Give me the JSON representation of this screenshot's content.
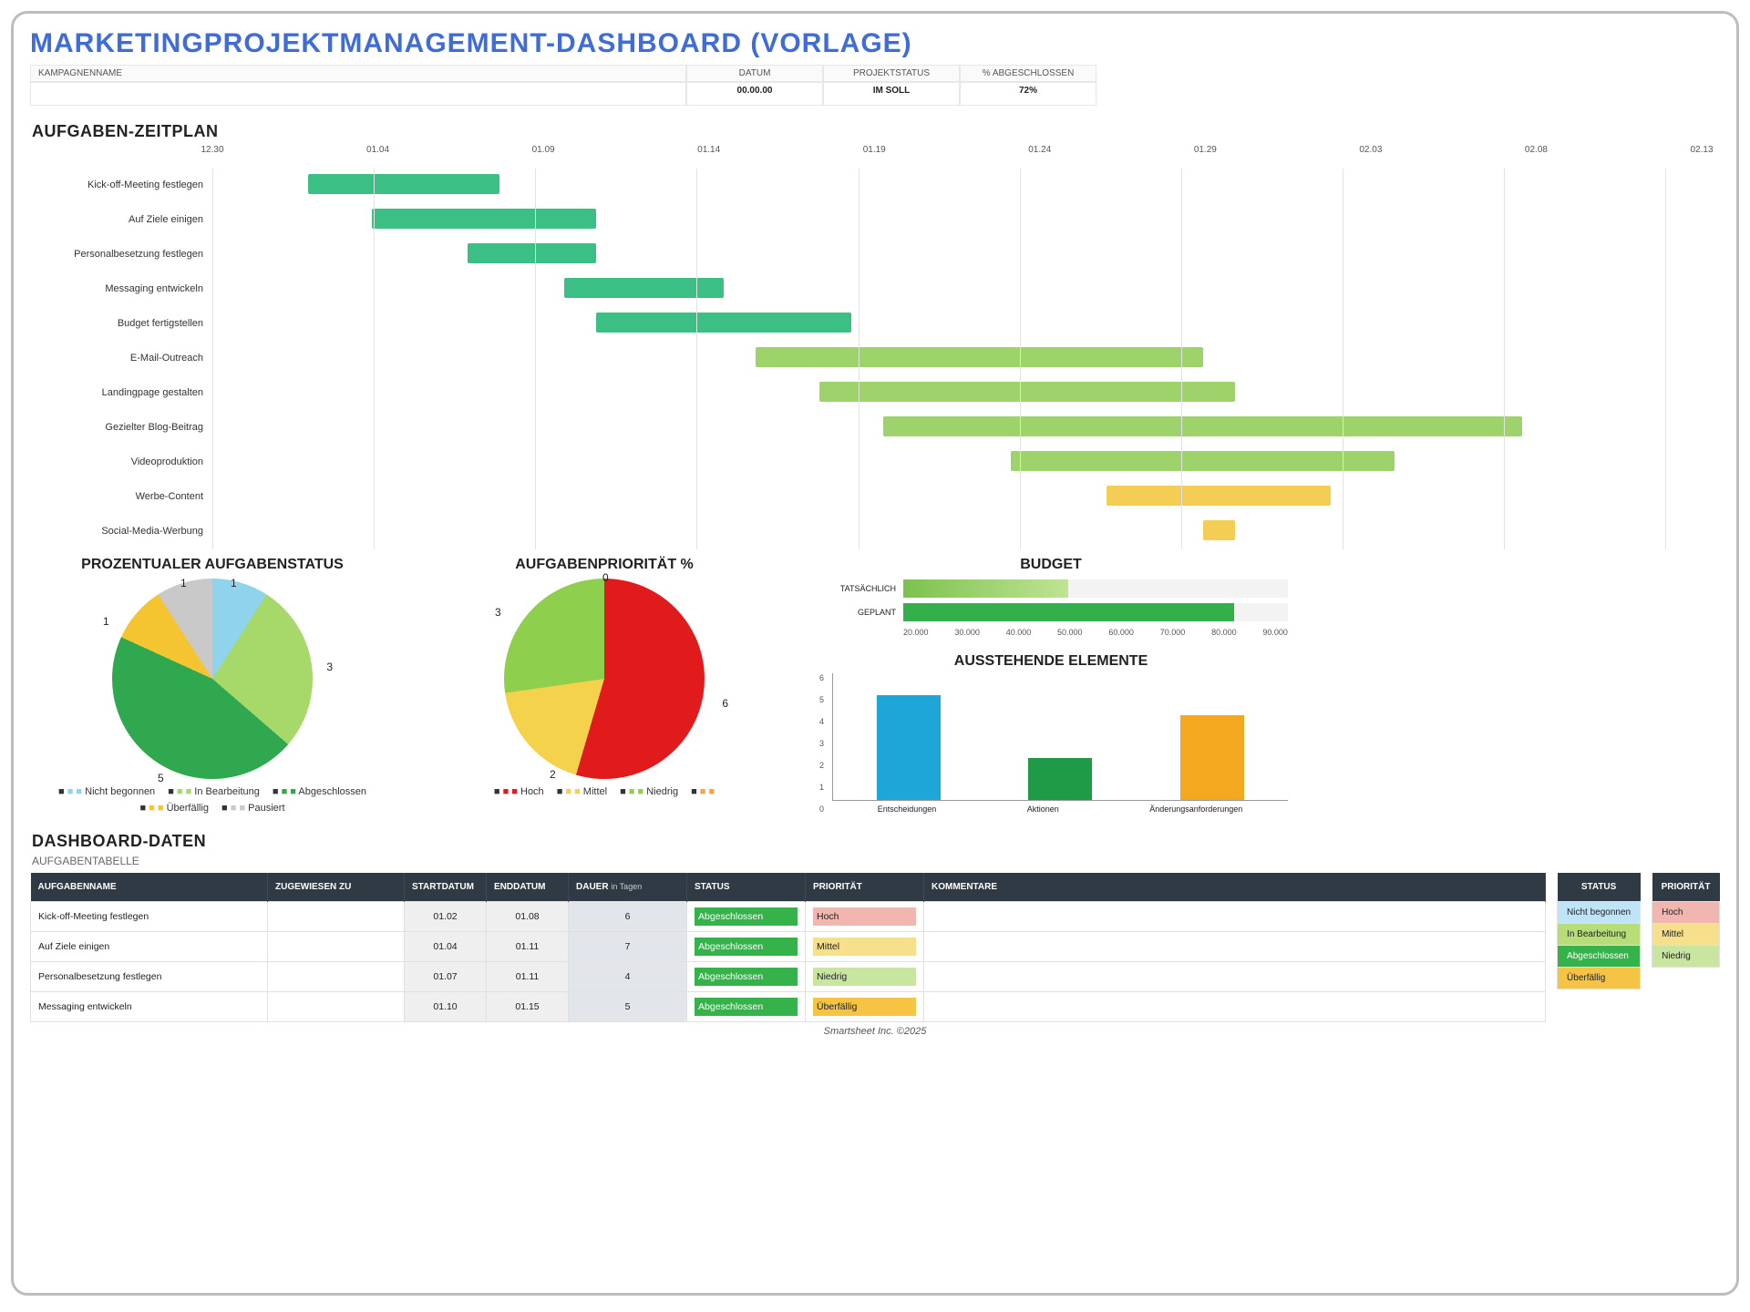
{
  "title": "MARKETINGPROJEKTMANAGEMENT-DASHBOARD (VORLAGE)",
  "header": {
    "labels": {
      "name": "KAMPAGNENNAME",
      "date": "DATUM",
      "status": "PROJEKTSTATUS",
      "pct": "% ABGESCHLOSSEN"
    },
    "values": {
      "name": "",
      "date": "00.00.00",
      "status": "IM SOLL",
      "pct": "72%"
    }
  },
  "sections": {
    "gantt": "AUFGABEN-ZEITPLAN",
    "data": "DASHBOARD-DATEN",
    "table": "AUFGABENTABELLE"
  },
  "chart_titles": {
    "pie_status": "PROZENTUALER AUFGABENSTATUS",
    "pie_priority": "AUFGABENPRIORITÄT %",
    "budget": "BUDGET",
    "outstanding": "AUSSTEHENDE ELEMENTE"
  },
  "gantt": {
    "axis": [
      "12.30",
      "01.04",
      "01.09",
      "01.14",
      "01.19",
      "01.24",
      "01.29",
      "02.03",
      "02.08",
      "02.13"
    ],
    "tasks": [
      {
        "label": "Kick-off-Meeting festlegen",
        "color": "#3bbf84"
      },
      {
        "label": "Auf Ziele einigen",
        "color": "#3bbf84"
      },
      {
        "label": "Personalbesetzung festlegen",
        "color": "#3bbf84"
      },
      {
        "label": "Messaging entwickeln",
        "color": "#3bbf84"
      },
      {
        "label": "Budget fertigstellen",
        "color": "#3bbf84"
      },
      {
        "label": "E-Mail-Outreach",
        "color": "#9ed26a"
      },
      {
        "label": "Landingpage gestalten",
        "color": "#9ed26a"
      },
      {
        "label": "Gezielter Blog-Beitrag",
        "color": "#9ed26a"
      },
      {
        "label": "Videoproduktion",
        "color": "#9ed26a"
      },
      {
        "label": "Werbe-Content",
        "color": "#f4cd55"
      },
      {
        "label": "Social-Media-Werbung",
        "color": "#f4cd55"
      }
    ]
  },
  "status_legend": {
    "items": [
      "Nicht begonnen",
      "In Bearbeitung",
      "Abgeschlossen",
      "Überfällig",
      "Pausiert"
    ],
    "colors": [
      "#8fd4ec",
      "#a6d96a",
      "#2fa84f",
      "#f4c531",
      "#c9c9c9"
    ]
  },
  "priority_legend": {
    "items": [
      "Hoch",
      "Mittel",
      "Niedrig",
      ""
    ],
    "colors": [
      "#e11b1b",
      "#f4d24b",
      "#8fcf4e",
      "#f2a640"
    ]
  },
  "budget_labels": {
    "actual": "TATSÄCHLICH",
    "planned": "GEPLANT"
  },
  "outstanding_labels": [
    "Entscheidungen",
    "Aktionen",
    "Änderungsanforderungen"
  ],
  "table": {
    "headers": {
      "task": "AUFGABENNAME",
      "assigned": "ZUGEWIESEN ZU",
      "start": "STARTDATUM",
      "end": "ENDDATUM",
      "dur": "DAUER",
      "dur_sub": "in Tagen",
      "status": "STATUS",
      "prio": "PRIORITÄT",
      "comments": "KOMMENTARE"
    },
    "rows": [
      {
        "task": "Kick-off-Meeting festlegen",
        "start": "01.02",
        "end": "01.08",
        "dur": "6",
        "status": "Abgeschlossen",
        "prio": "Hoch"
      },
      {
        "task": "Auf Ziele einigen",
        "start": "01.04",
        "end": "01.11",
        "dur": "7",
        "status": "Abgeschlossen",
        "prio": "Mittel"
      },
      {
        "task": "Personalbesetzung festlegen",
        "start": "01.07",
        "end": "01.11",
        "dur": "4",
        "status": "Abgeschlossen",
        "prio": "Niedrig"
      },
      {
        "task": "Messaging entwickeln",
        "start": "01.10",
        "end": "01.15",
        "dur": "5",
        "status": "Abgeschlossen",
        "prio": "Überfällig"
      }
    ]
  },
  "side": {
    "status_header": "STATUS",
    "prio_header": "PRIORITÄT",
    "status_rows": [
      "Nicht begonnen",
      "In Bearbeitung",
      "Abgeschlossen",
      "Überfällig"
    ],
    "prio_rows": [
      "Hoch",
      "Mittel",
      "Niedrig"
    ]
  },
  "footer": "Smartsheet Inc. ©2025",
  "chart_data": [
    {
      "type": "gantt",
      "title": "AUFGABEN-ZEITPLAN",
      "x_axis_dates": [
        "12.30",
        "01.04",
        "01.09",
        "01.14",
        "01.19",
        "01.24",
        "01.29",
        "02.03",
        "02.08",
        "02.13"
      ],
      "tasks": [
        {
          "name": "Kick-off-Meeting festlegen",
          "start": "01.02",
          "end": "01.08",
          "status": "Abgeschlossen"
        },
        {
          "name": "Auf Ziele einigen",
          "start": "01.04",
          "end": "01.11",
          "status": "Abgeschlossen"
        },
        {
          "name": "Personalbesetzung festlegen",
          "start": "01.07",
          "end": "01.11",
          "status": "Abgeschlossen"
        },
        {
          "name": "Messaging entwickeln",
          "start": "01.10",
          "end": "01.15",
          "status": "Abgeschlossen"
        },
        {
          "name": "Budget fertigstellen",
          "start": "01.11",
          "end": "01.19",
          "status": "Abgeschlossen"
        },
        {
          "name": "E-Mail-Outreach",
          "start": "01.16",
          "end": "01.30",
          "status": "In Bearbeitung"
        },
        {
          "name": "Landingpage gestalten",
          "start": "01.18",
          "end": "01.31",
          "status": "In Bearbeitung"
        },
        {
          "name": "Gezielter Blog-Beitrag",
          "start": "01.20",
          "end": "02.09",
          "status": "In Bearbeitung"
        },
        {
          "name": "Videoproduktion",
          "start": "01.24",
          "end": "02.05",
          "status": "In Bearbeitung"
        },
        {
          "name": "Werbe-Content",
          "start": "01.27",
          "end": "02.03",
          "status": "Überfällig"
        },
        {
          "name": "Social-Media-Werbung",
          "start": "01.30",
          "end": "01.31",
          "status": "Überfällig"
        }
      ]
    },
    {
      "type": "pie",
      "title": "PROZENTUALER AUFGABENSTATUS",
      "series": [
        {
          "name": "Nicht begonnen",
          "value": 1,
          "color": "#8fd4ec"
        },
        {
          "name": "In Bearbeitung",
          "value": 3,
          "color": "#a6d96a"
        },
        {
          "name": "Abgeschlossen",
          "value": 5,
          "color": "#2fa84f"
        },
        {
          "name": "Überfällig",
          "value": 1,
          "color": "#f4c531"
        },
        {
          "name": "Pausiert",
          "value": 1,
          "color": "#c9c9c9"
        }
      ]
    },
    {
      "type": "pie",
      "title": "AUFGABENPRIORITÄT %",
      "series": [
        {
          "name": "Hoch",
          "value": 6,
          "color": "#e11b1b"
        },
        {
          "name": "Mittel",
          "value": 2,
          "color": "#f4d24b"
        },
        {
          "name": "Niedrig",
          "value": 3,
          "color": "#8fcf4e"
        },
        {
          "name": "",
          "value": 0,
          "color": "#f2a640"
        }
      ]
    },
    {
      "type": "bar",
      "orientation": "horizontal",
      "title": "BUDGET",
      "categories": [
        "TATSÄCHLICH",
        "GEPLANT"
      ],
      "values": [
        50000,
        80000
      ],
      "xlim": [
        20000,
        90000
      ],
      "x_ticks": [
        20000,
        30000,
        40000,
        50000,
        60000,
        70000,
        80000,
        90000
      ]
    },
    {
      "type": "bar",
      "orientation": "vertical",
      "title": "AUSSTEHENDE ELEMENTE",
      "categories": [
        "Entscheidungen",
        "Aktionen",
        "Änderungsanforderungen"
      ],
      "values": [
        5,
        2,
        4
      ],
      "colors": [
        "#1fa6d9",
        "#1f9a47",
        "#f3a81f"
      ],
      "ylim": [
        0,
        6
      ],
      "y_ticks": [
        0,
        1,
        2,
        3,
        4,
        5,
        6
      ]
    }
  ]
}
